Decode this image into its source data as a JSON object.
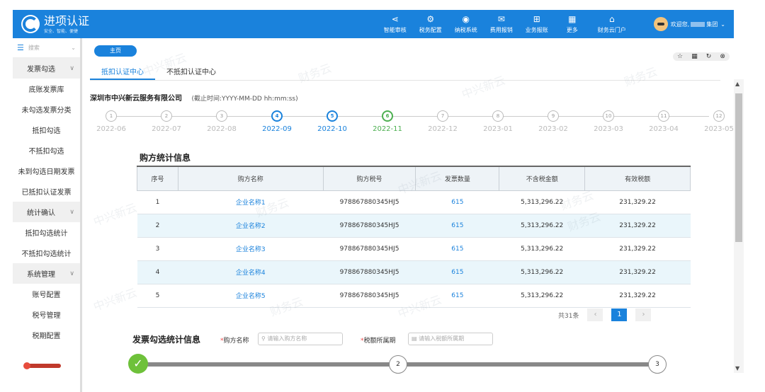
{
  "app": {
    "title": "进项认证",
    "subtitle": "安全、智能、便捷"
  },
  "nav": [
    {
      "icon": "share-icon",
      "glyph": "⋖",
      "label": "智能审核"
    },
    {
      "icon": "tax-config-icon",
      "glyph": "⚙",
      "label": "税务配置"
    },
    {
      "icon": "tax-system-icon",
      "glyph": "◉",
      "label": "纳税系统"
    },
    {
      "icon": "expense-icon",
      "glyph": "✉",
      "label": "费用报销"
    },
    {
      "icon": "business-icon",
      "glyph": "⊞",
      "label": "业务报账"
    },
    {
      "icon": "more-icon",
      "glyph": "▦",
      "label": "更多"
    },
    {
      "icon": "home-icon",
      "glyph": "⌂",
      "label": "财务云门户"
    }
  ],
  "user": {
    "greeting": "欢迎您,",
    "suffix": "集团"
  },
  "sidebar": {
    "search_placeholder": "搜索",
    "sections": [
      {
        "group": "发票勾选",
        "items": [
          "底账发票库",
          "未勾选发票分类",
          "抵扣勾选",
          "不抵扣勾选",
          "未到勾选日期发票",
          "已抵扣认证发票"
        ]
      },
      {
        "group": "统计确认",
        "items": [
          "抵扣勾选统计",
          "不抵扣勾选统计"
        ]
      },
      {
        "group": "系统管理",
        "items": [
          "账号配置",
          "税号管理",
          "税期配置"
        ]
      }
    ]
  },
  "home_tab": "主页",
  "tabs": [
    "抵扣认证中心",
    "不抵扣认证中心"
  ],
  "company": {
    "name": "深圳市中兴新云服务有限公司",
    "deadline": "(截止时间:YYYY-MM-DD hh:mm:ss)"
  },
  "periods": [
    {
      "n": "1",
      "label": "2022-06",
      "state": "gray"
    },
    {
      "n": "2",
      "label": "2022-07",
      "state": "gray"
    },
    {
      "n": "3",
      "label": "2022-08",
      "state": "gray"
    },
    {
      "n": "4",
      "label": "2022-09",
      "state": "blue"
    },
    {
      "n": "5",
      "label": "2022-10",
      "state": "blue"
    },
    {
      "n": "6",
      "label": "2022-11",
      "state": "green"
    },
    {
      "n": "7",
      "label": "2022-12",
      "state": "gray"
    },
    {
      "n": "8",
      "label": "2023-01",
      "state": "gray"
    },
    {
      "n": "9",
      "label": "2023-02",
      "state": "gray"
    },
    {
      "n": "10",
      "label": "2023-03",
      "state": "gray"
    },
    {
      "n": "11",
      "label": "2023-04",
      "state": "gray"
    },
    {
      "n": "12",
      "label": "2023-05",
      "state": "gray"
    }
  ],
  "buyer_stats": {
    "title": "购方统计信息",
    "columns": [
      "序号",
      "购方名称",
      "购方税号",
      "发票数量",
      "不含税金额",
      "有效税额"
    ],
    "rows": [
      [
        "1",
        "企业名称1",
        "978867880345HJ5",
        "615",
        "5,313,296.22",
        "231,329.22"
      ],
      [
        "2",
        "企业名称2",
        "978867880345HJ5",
        "615",
        "5,313,296.22",
        "231,329.22"
      ],
      [
        "3",
        "企业名称3",
        "978867880345HJ5",
        "615",
        "5,313,296.22",
        "231,329.22"
      ],
      [
        "4",
        "企业名称4",
        "978867880345HJ5",
        "615",
        "5,313,296.22",
        "231,329.22"
      ],
      [
        "5",
        "企业名称5",
        "978867880345HJ5",
        "615",
        "5,313,296.22",
        "231,329.22"
      ]
    ],
    "total": "共31条",
    "current_page": "1"
  },
  "invoice_stats": {
    "title": "发票勾选统计信息",
    "buyer_label": "购方名称",
    "buyer_placeholder": "请输入购方名称",
    "period_label": "税额所属期",
    "period_placeholder": "请输入税额所属期",
    "steps": [
      "2",
      "3"
    ]
  },
  "watermark": {
    "cn": "中兴新云",
    "brand": "财务云"
  }
}
